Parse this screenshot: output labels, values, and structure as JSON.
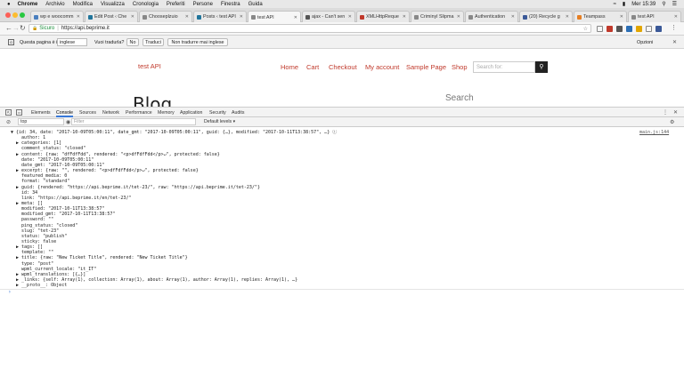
{
  "menubar": {
    "apple": "",
    "items": [
      "Chrome",
      "Archivio",
      "Modifica",
      "Visualizza",
      "Cronologia",
      "Preferiti",
      "Persone",
      "Finestra",
      "Guida"
    ],
    "clock": "Mer 15:39"
  },
  "tabs": [
    {
      "label": "wp e woocomm",
      "color": "#4a7fbf"
    },
    {
      "label": "Edit Post ‹ Che",
      "color": "#21759b"
    },
    {
      "label": "Chooseplzuio",
      "color": "#888888"
    },
    {
      "label": "Posts ‹ test API",
      "color": "#21759b"
    },
    {
      "label": "test API",
      "color": "#888888"
    },
    {
      "label": "ajax - Can't sen",
      "color": "#555555"
    },
    {
      "label": "XMLHttpReque",
      "color": "#c0392b"
    },
    {
      "label": "Criminyl Slipma",
      "color": "#888888"
    },
    {
      "label": "Authentication",
      "color": "#888888"
    },
    {
      "label": "(20) Recycle g",
      "color": "#3b5998"
    },
    {
      "label": "Teampass",
      "color": "#e67e22"
    },
    {
      "label": "test API",
      "color": "#888888"
    }
  ],
  "address": {
    "secure_label": "Sicuro",
    "url": "https://api.beprime.it"
  },
  "translate": {
    "prompt": "Questa pagina è in",
    "language": "inglese",
    "question": "Vuoi tradurla?",
    "no": "No",
    "translate": "Traduci",
    "never": "Non tradurre mai inglese",
    "options": "Opzioni"
  },
  "site": {
    "logo": "test API",
    "nav": [
      "Home",
      "Cart",
      "Checkout",
      "My account",
      "Sample Page",
      "Shop"
    ],
    "search_placeholder": "Search for:",
    "heading": "Blog",
    "sidebar_heading": "Search"
  },
  "devtools": {
    "tabs": [
      "Elements",
      "Console",
      "Sources",
      "Network",
      "Performance",
      "Memory",
      "Application",
      "Security",
      "Audits"
    ],
    "active_tab": "Console",
    "context": "top",
    "filter_placeholder": "Filter",
    "levels": "Default levels ▾",
    "source_ref": "main.js:144"
  },
  "console_lines": [
    "▼ {id: 34, date: \"2017-10-09T05:00:11\", date_gmt: \"2017-10-09T05:00:11\", guid: {…}, modified: \"2017-10-11T13:38:57\", …} ⓘ",
    "    author: 1",
    "  ▶ categories: [1]",
    "    comment_status: \"closed\"",
    "  ▶ content: {raw: \"dfFdfFdd\", rendered: \"<p>dfFdfFdd</p>↵\", protected: false}",
    "    date: \"2017-10-09T05:00:11\"",
    "    date_gmt: \"2017-10-09T05:00:11\"",
    "  ▶ excerpt: {raw: \"\", rendered: \"<p>dfFdfFdd</p>↵\", protected: false}",
    "    featured_media: 0",
    "    format: \"standard\"",
    "  ▶ guid: {rendered: \"https://api.beprime.it/tet-23/\", raw: \"https://api.beprime.it/tet-23/\"}",
    "    id: 34",
    "    link: \"https://api.beprime.it/en/tet-23/\"",
    "  ▶ meta: []",
    "    modified: \"2017-10-11T13:38:57\"",
    "    modified_gmt: \"2017-10-11T13:38:57\"",
    "    password: \"\"",
    "    ping_status: \"closed\"",
    "    slug: \"tet-23\"",
    "    status: \"publish\"",
    "    sticky: false",
    "  ▶ tags: []",
    "    template: \"\"",
    "  ▶ title: {raw: \"New Ticket Title\", rendered: \"New Ticket Title\"}",
    "    type: \"post\"",
    "    wpml_current_locale: \"it_IT\"",
    "  ▶ wpml_translations: [{…}]",
    "  ▶ _links: {self: Array(1), collection: Array(1), about: Array(1), author: Array(1), replies: Array(1), …}",
    "  ▶ __proto__: Object"
  ],
  "colors": {
    "site_accent": "#c0392b",
    "devtools_active": "#3879d9",
    "secure_green": "#1a8f3c"
  }
}
